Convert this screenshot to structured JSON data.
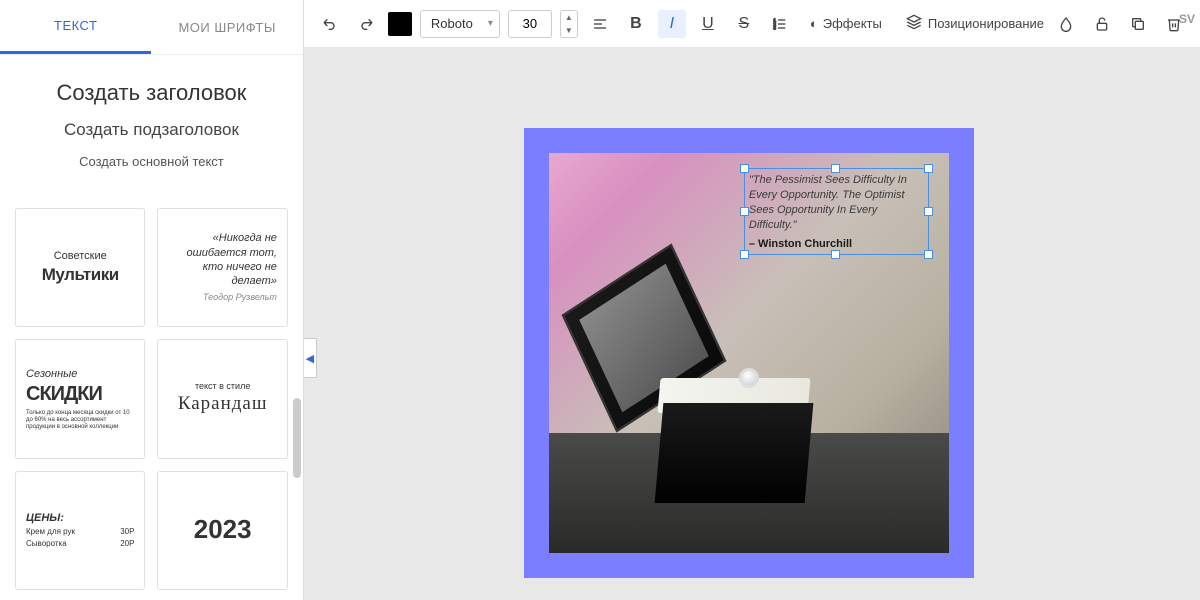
{
  "sidebar": {
    "tabs": {
      "text": "ТЕКСТ",
      "fonts": "МОИ ШРИФТЫ"
    },
    "creators": {
      "h1": "Создать заголовок",
      "h2": "Создать подзаголовок",
      "p": "Создать основной текст"
    },
    "templates": [
      {
        "line1": "Советские",
        "line2": "Мультики"
      },
      {
        "quote": "«Никогда не ошибается тот, кто ничего не делает»",
        "author": "Теодор Рузвельт"
      },
      {
        "line1": "Сезонные",
        "line2": "СКИДКИ",
        "line3": "Только до конца месяца скидки от 10 до 60% на весь ассортимент продукции в основной коллекции"
      },
      {
        "line1": "текст в стиле",
        "line2": "Карандаш"
      },
      {
        "title": "ЦЕНЫ:",
        "rows": [
          {
            "name": "Крем для рук",
            "price": "30Р"
          },
          {
            "name": "Сыворотка",
            "price": "20Р"
          }
        ]
      },
      {
        "year": "2023"
      }
    ]
  },
  "toolbar": {
    "font": "Roboto",
    "size": "30",
    "effects": "Эффекты",
    "positioning": "Позиционирование"
  },
  "canvas": {
    "quote": "\"The Pessimist Sees Difficulty In Every Opportunity. The Optimist Sees Opportunity In Every Difficulty.\"",
    "author": "– Winston Churchill"
  },
  "hint": "SV"
}
